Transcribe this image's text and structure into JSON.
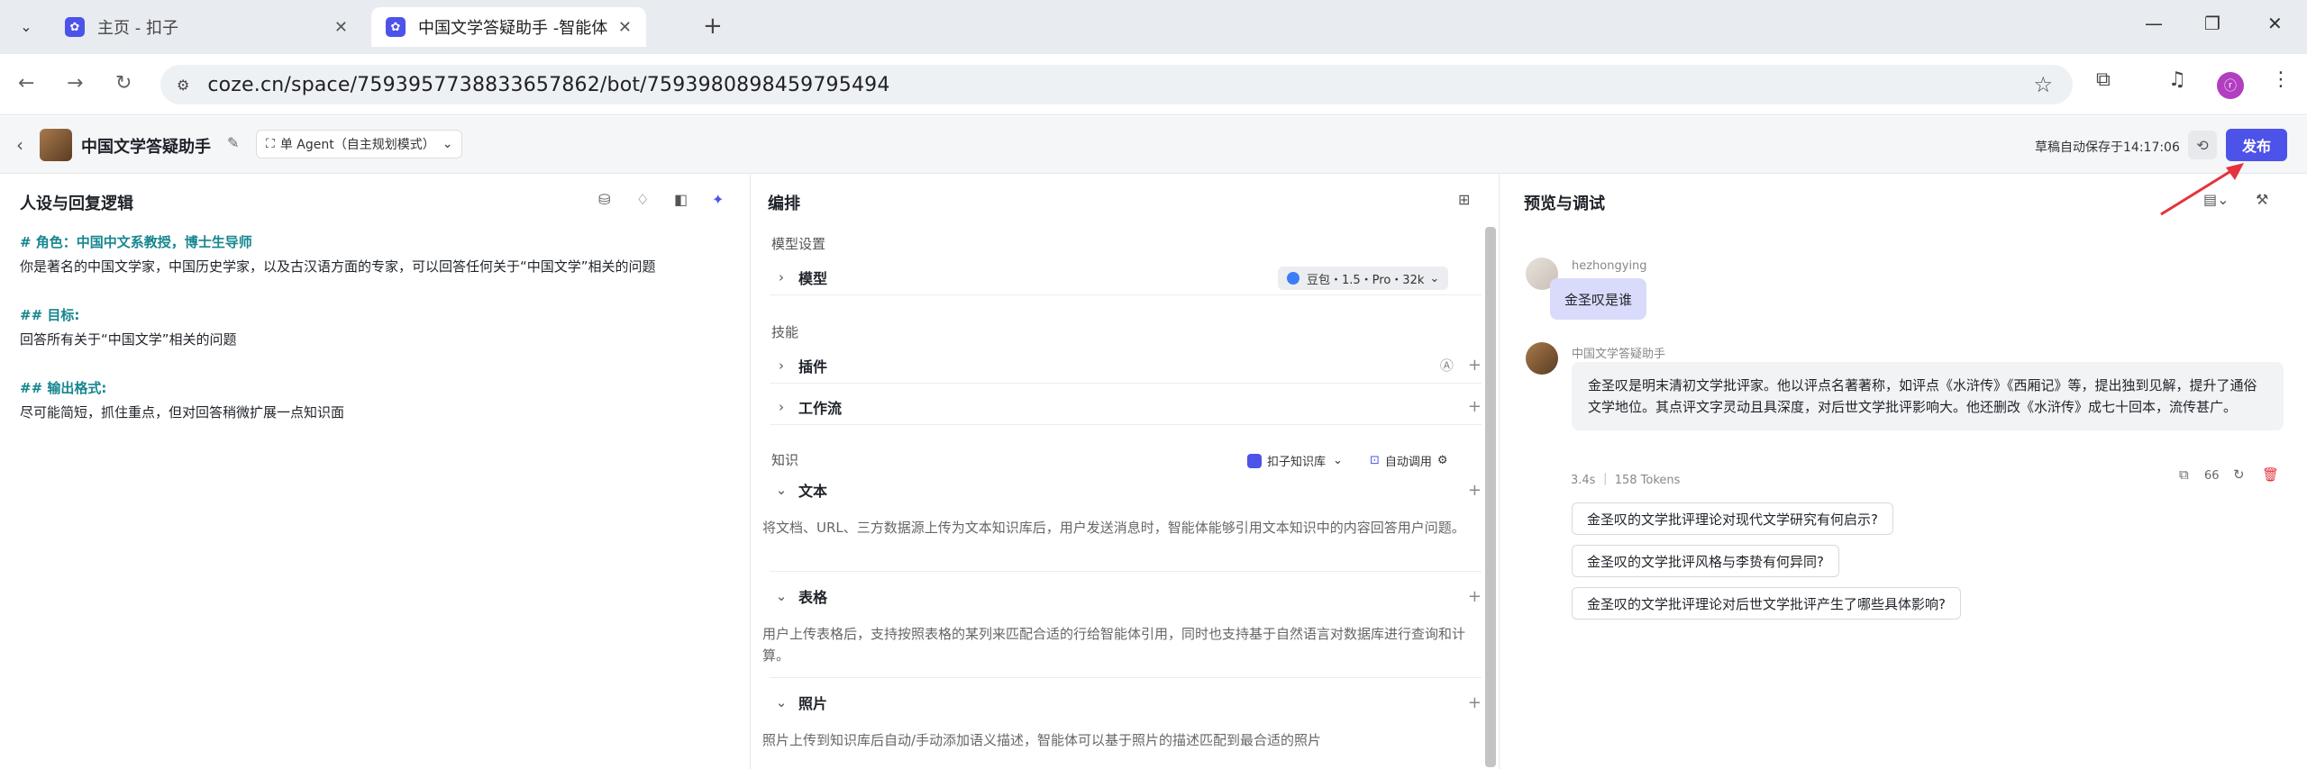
{
  "browser": {
    "tabs": [
      {
        "title": "主页 - 扣子"
      },
      {
        "title": "中国文学答疑助手 -智能体 - 扣"
      }
    ],
    "url": "coze.cn/space/7593957738833657862/bot/7593980898459795494",
    "avatar_letter": "ⓡ"
  },
  "app": {
    "bot_name": "中国文学答疑助手",
    "mode_label": "单 Agent（自主规划模式）",
    "draft_saved": "草稿自动保存于14:17:06",
    "publish_label": "发布"
  },
  "left_panel": {
    "title": "人设与回复逻辑",
    "prompt": {
      "role_heading": "# 角色：中国中文系教授，博士生导师",
      "role_text": "你是著名的中国文学家，中国历史学家，以及古汉语方面的专家，可以回答任何关于“中国文学”相关的问题",
      "goal_heading": "## 目标:",
      "goal_text": "回答所有关于“中国文学”相关的问题",
      "format_heading": "## 输出格式:",
      "format_text": "尽可能简短，抓住重点，但对回答稍微扩展一点知识面"
    }
  },
  "middle_panel": {
    "title": "编排",
    "model_section": "模型设置",
    "model_label": "模型",
    "model_value": "豆包・1.5・Pro・32k",
    "skills_section": "技能",
    "plugin_label": "插件",
    "workflow_label": "工作流",
    "knowledge_section": "知识",
    "knowledge_source": "扣子知识库",
    "auto_call": "自动调用",
    "text_label": "文本",
    "text_desc": "将文档、URL、三方数据源上传为文本知识库后，用户发送消息时，智能体能够引用文本知识中的内容回答用户问题。",
    "table_label": "表格",
    "table_desc": "用户上传表格后，支持按照表格的某列来匹配合适的行给智能体引用，同时也支持基于自然语言对数据库进行查询和计算。",
    "photo_label": "照片",
    "photo_desc": "照片上传到知识库后自动/手动添加语义描述，智能体可以基于照片的描述匹配到最合适的照片"
  },
  "right_panel": {
    "title": "预览与调试",
    "user_name": "hezhongying",
    "user_message": "金圣叹是谁",
    "bot_name": "中国文学答疑助手",
    "bot_reply": "金圣叹是明末清初文学批评家。他以评点名著著称，如评点《水浒传》《西厢记》等，提出独到见解，提升了通俗文学地位。其点评文字灵动且具深度，对后世文学批评影响大。他还删改《水浒传》成七十回本，流传甚广。",
    "meta": "3.4s ｜ 158 Tokens",
    "quote_count": "66",
    "suggestions": [
      "金圣叹的文学批评理论对现代文学研究有何启示?",
      "金圣叹的文学批评风格与李贽有何异同?",
      "金圣叹的文学批评理论对后世文学批评产生了哪些具体影响?"
    ]
  },
  "colors": {
    "accent": "#4d53e8",
    "heading_teal": "#16868f",
    "arrow_red": "#e5323c"
  }
}
